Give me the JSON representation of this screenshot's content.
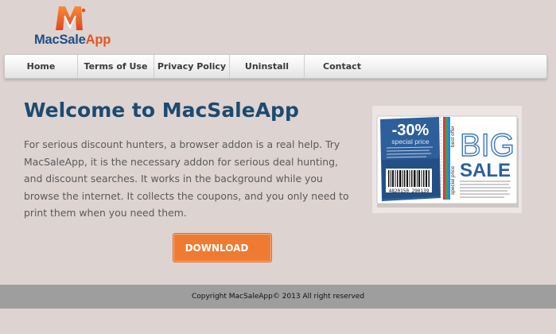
{
  "logo": {
    "brand_prefix": "MacSale",
    "brand_suffix": "App",
    "mark_icon": "m-letter-logo-icon"
  },
  "nav": {
    "items": [
      {
        "label": "Home"
      },
      {
        "label": "Terms of Use"
      },
      {
        "label": "Privacy Policy"
      },
      {
        "label": "Uninstall"
      },
      {
        "label": "Contact"
      }
    ]
  },
  "main": {
    "title": "Welcome to MacSaleApp",
    "description": "For serious discount hunters, a browser addon is a real help. Try MacSaleApp, it is the necessary addon for serious deal hunting, and discount searches. It works in the background while you browse the internet. It collects the coupons, and you only need to print them when you need them.",
    "download_label": "DOWNLOAD"
  },
  "promo": {
    "discount": "-30%",
    "subtitle": "special price",
    "big": "BIG",
    "sale": "SALE",
    "barcode_number": "4820150 290139",
    "side_top": "best offer",
    "side_bottom": "special price"
  },
  "footer": {
    "copyright": "Copyright MacSaleApp© 2013 All right reserved"
  },
  "colors": {
    "background": "#ddd3d1",
    "title": "#1e4a6e",
    "accent": "#ef7b33",
    "brand_blue": "#1d4f86",
    "footer": "#9e9e9e"
  }
}
